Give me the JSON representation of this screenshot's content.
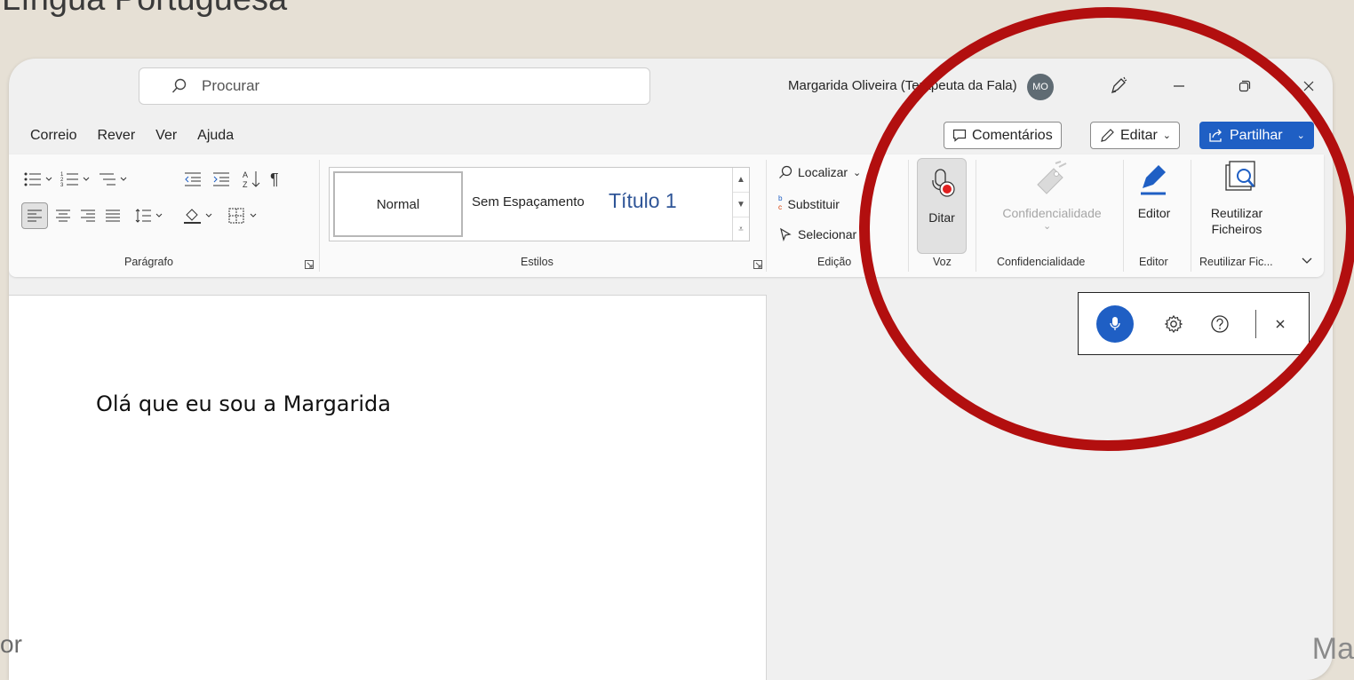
{
  "slide": {
    "title_fragment": "Língua Portuguesa",
    "footer_left": "or",
    "footer_right": "Ma"
  },
  "titlebar": {
    "search_placeholder": "Procurar",
    "user_name": "Margarida Oliveira (Terapeuta da Fala)",
    "avatar_initials": "MO"
  },
  "tabs": [
    {
      "label": "Correio"
    },
    {
      "label": "Rever"
    },
    {
      "label": "Ver"
    },
    {
      "label": "Ajuda"
    }
  ],
  "actions": {
    "comments": "Comentários",
    "edit": "Editar",
    "share": "Partilhar"
  },
  "ribbon": {
    "paragraph_label": "Parágrafo",
    "styles": {
      "label": "Estilos",
      "normal": "Normal",
      "no_spacing": "Sem Espaçamento",
      "title1": "Título 1"
    },
    "editing": {
      "label": "Edição",
      "find": "Localizar",
      "replace": "Substituir",
      "select": "Selecionar"
    },
    "voice": {
      "label": "Voz",
      "dictate": "Ditar"
    },
    "sensitivity": {
      "label": "Confidencialidade",
      "button": "Confidencialidade"
    },
    "editor": {
      "label": "Editor",
      "button": "Editor"
    },
    "reuse": {
      "label": "Reutilizar Fic...",
      "button_line1": "Reutilizar",
      "button_line2": "Ficheiros"
    }
  },
  "document": {
    "text": "Olá que eu sou a Margarida"
  },
  "colors": {
    "accent": "#1f5fc4",
    "annotation": "#b20f0f"
  }
}
